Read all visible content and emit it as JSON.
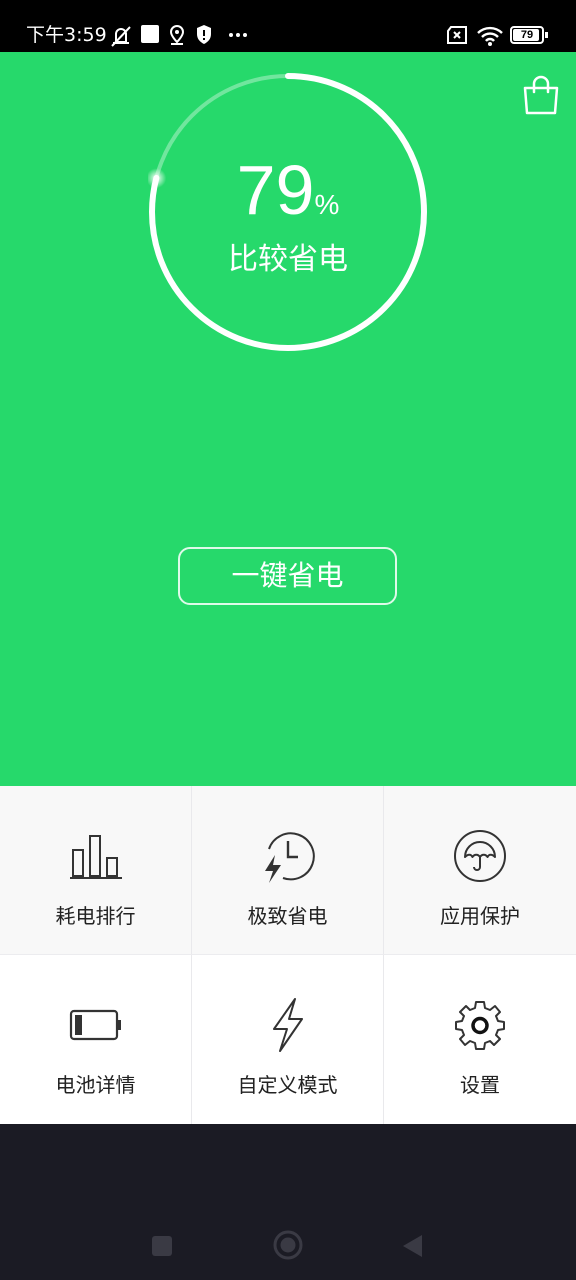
{
  "status_bar": {
    "time": "下午3:59",
    "battery_level": "79",
    "icons": [
      "mute-icon",
      "square-icon",
      "location-icon",
      "shield-icon",
      "more-icon",
      "sim-icon",
      "wifi-icon",
      "battery-icon"
    ]
  },
  "hero": {
    "battery_percent": "79",
    "percent_sign": "%",
    "status": "比较省电",
    "ring_fraction": 0.79,
    "save_button": "一键省电",
    "background": "#26d96b"
  },
  "grid": {
    "items": [
      {
        "label": "耗电排行",
        "icon": "bar-chart-icon"
      },
      {
        "label": "极致省电",
        "icon": "clock-lightning-icon"
      },
      {
        "label": "应用保护",
        "icon": "umbrella-icon"
      },
      {
        "label": "电池详情",
        "icon": "battery-icon"
      },
      {
        "label": "自定义模式",
        "icon": "lightning-icon"
      },
      {
        "label": "设置",
        "icon": "gear-icon"
      }
    ]
  },
  "nav": {
    "buttons": [
      "recents",
      "home",
      "back"
    ]
  }
}
